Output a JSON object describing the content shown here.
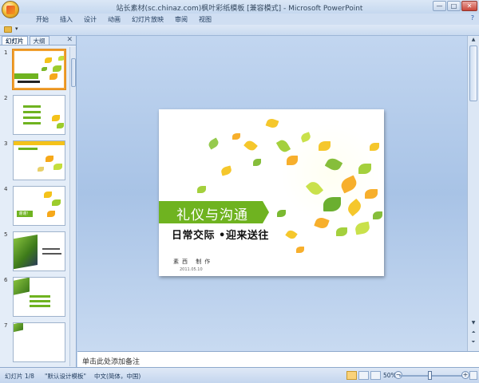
{
  "window": {
    "title": "站长素材(sc.chinaz.com)枫叶彩纸模板 [兼容模式] - Microsoft PowerPoint",
    "controls": [
      "—",
      "□",
      "✕"
    ]
  },
  "ribbon": {
    "tabs": [
      "开始",
      "插入",
      "设计",
      "动画",
      "幻灯片放映",
      "审阅",
      "视图"
    ],
    "help": "?"
  },
  "left_pane": {
    "tabs": [
      "幻灯片",
      "大纲"
    ],
    "close": "✕",
    "slide_numbers": [
      "1",
      "2",
      "3",
      "4",
      "5",
      "6",
      "7"
    ],
    "thumb4_label": "谢谢！"
  },
  "slide": {
    "title": "礼仪与沟通",
    "subtitle": "日常交际 •迎来送往",
    "author": "素西 制作",
    "date": "2011.05.10"
  },
  "notes": {
    "placeholder": "单击此处添加备注"
  },
  "status_bar": {
    "slide_counter": "幻灯片 1/8",
    "theme": "\"默认设计模板\"",
    "language": "中文(简体，中国)",
    "zoom": "50%",
    "zoom_minus": "−",
    "zoom_plus": "+"
  },
  "colors": {
    "accent_green": "#6fb320",
    "selected_thumb": "#f0a030"
  }
}
